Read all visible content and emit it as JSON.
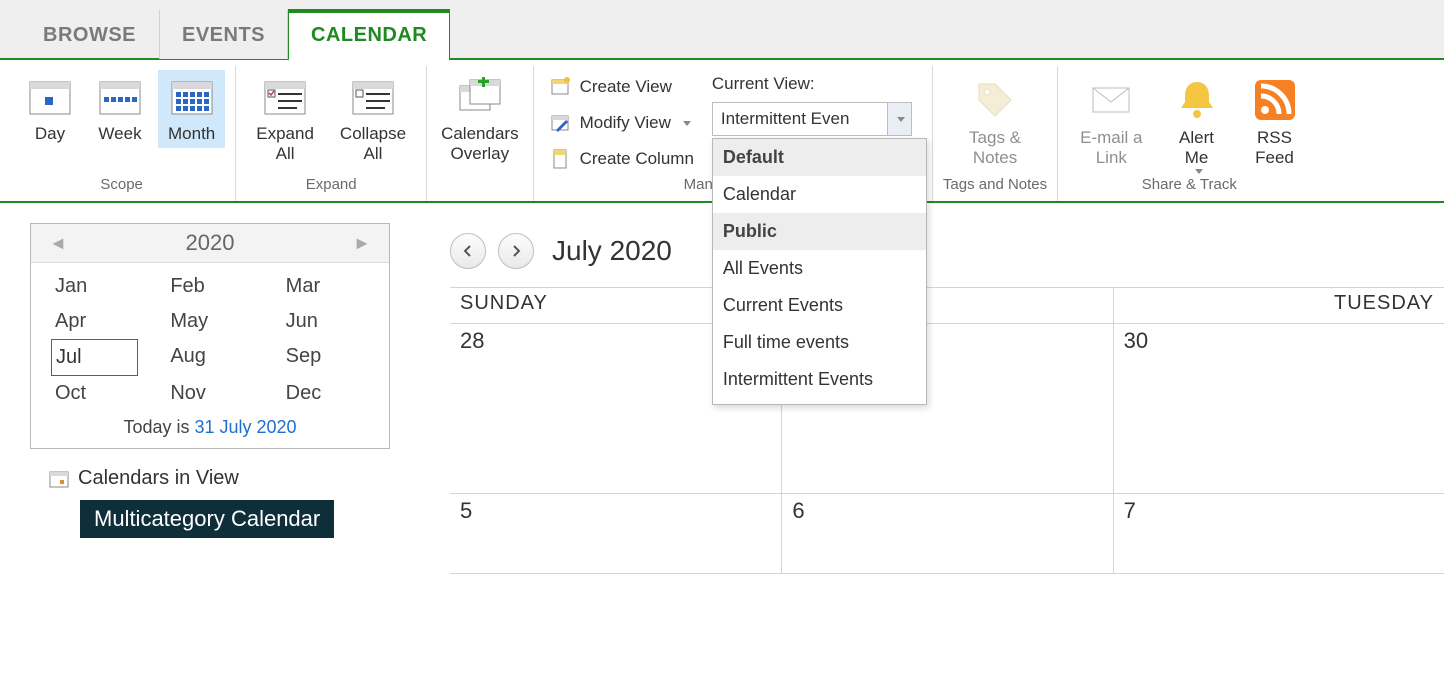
{
  "tabs": {
    "browse": "BROWSE",
    "events": "EVENTS",
    "calendar": "CALENDAR"
  },
  "ribbon": {
    "scope": {
      "label": "Scope",
      "day": "Day",
      "week": "Week",
      "month": "Month"
    },
    "expand": {
      "label": "Expand",
      "expandAll": "Expand\nAll",
      "collapseAll": "Collapse\nAll"
    },
    "calOverlay": "Calendars\nOverlay",
    "manage": {
      "label": "Manage Views",
      "createView": "Create View",
      "modifyView": "Modify View",
      "createColumn": "Create Column",
      "currentViewLabel": "Current View:",
      "currentViewValue": "Intermittent Even"
    },
    "viewMenu": {
      "default": "Default",
      "calendar": "Calendar",
      "public": "Public",
      "allEvents": "All Events",
      "currentEvents": "Current Events",
      "fullTime": "Full time events",
      "intermittent": "Intermittent Events"
    },
    "tagsNotes": {
      "btn": "Tags &\nNotes",
      "label": "Tags and Notes"
    },
    "share": {
      "label": "Share & Track",
      "email": "E-mail a\nLink",
      "alert": "Alert\nMe",
      "rss": "RSS\nFeed"
    }
  },
  "mini": {
    "year": "2020",
    "months": [
      "Jan",
      "Feb",
      "Mar",
      "Apr",
      "May",
      "Jun",
      "Jul",
      "Aug",
      "Sep",
      "Oct",
      "Nov",
      "Dec"
    ],
    "todayPrefix": "Today is ",
    "todayDate": "31 July 2020",
    "civLabel": "Calendars in View",
    "civItem": "Multicategory Calendar"
  },
  "big": {
    "title": "July 2020",
    "dayHeaders": [
      "SUNDAY",
      "",
      "TUESDAY"
    ],
    "row1": [
      "28",
      "",
      "30"
    ],
    "row2": [
      "5",
      "6",
      "7"
    ]
  }
}
